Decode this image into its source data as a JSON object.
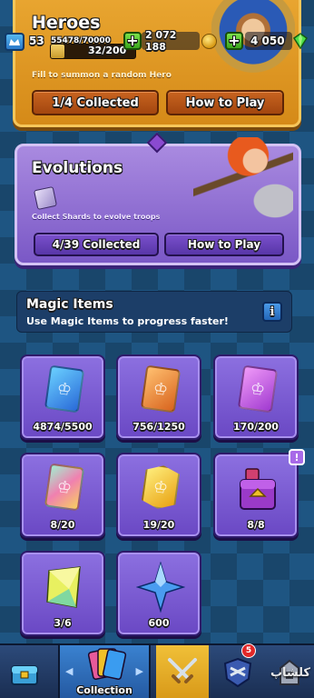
{
  "heroes": {
    "title": "Heroes",
    "progress_text": "32/200",
    "progress_fraction": 0.16,
    "subtitle": "Fill to summon a random Hero",
    "collected_label": "1/4 Collected",
    "how_to_play_label": "How to Play"
  },
  "resources": {
    "level": "53",
    "xp": "55478/70000",
    "gold": "2 072 188",
    "gems": "4 050"
  },
  "evolutions": {
    "title": "Evolutions",
    "subtitle": "Collect Shards to evolve troops",
    "collected_label": "4/39 Collected",
    "how_to_play_label": "How to Play"
  },
  "magic_items": {
    "title": "Magic Items",
    "subtitle": "Use Magic Items to progress faster!",
    "info_label": "i",
    "items": [
      {
        "name": "common-wild-card",
        "count": "4874/5500",
        "color": "#3a8ce8"
      },
      {
        "name": "rare-wild-card",
        "count": "756/1250",
        "color": "#e8842a"
      },
      {
        "name": "epic-wild-card",
        "count": "170/200",
        "color": "#c060e0"
      },
      {
        "name": "legendary-wild-card",
        "count": "8/20",
        "color": "#f0a0c0"
      },
      {
        "name": "champion-wild-card",
        "count": "19/20",
        "color": "#f0c028"
      },
      {
        "name": "chest",
        "count": "8/8",
        "color": "#9a3ac8"
      },
      {
        "name": "elite-wild-card",
        "count": "3/6",
        "color": "#d8e860"
      },
      {
        "name": "star-points",
        "count": "600",
        "color": "#3a8ce8"
      }
    ],
    "chest_badge": "!"
  },
  "nav": {
    "collection_label": "Collection",
    "clan_badge": "5"
  },
  "watermark": "کلشاپ"
}
